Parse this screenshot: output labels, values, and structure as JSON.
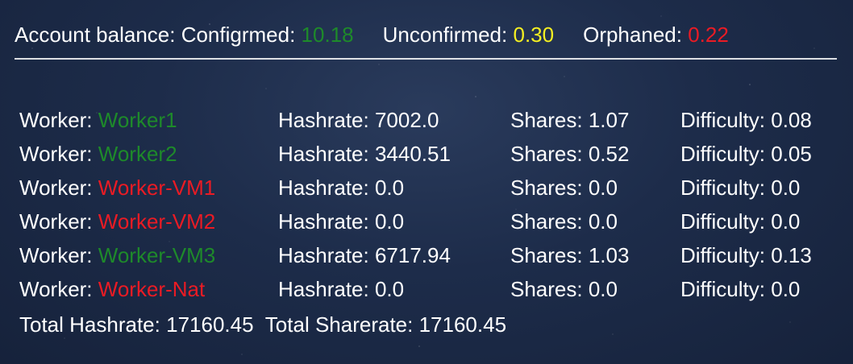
{
  "colors": {
    "confirmed": "#1e8a2a",
    "unconfirmed": "#f4ef22",
    "orphaned": "#ea1b24",
    "worker_active": "#1e8a2a",
    "worker_inactive": "#ea1b24"
  },
  "balance": {
    "confirmed_label": "Account balance: Configrmed:",
    "confirmed_value": "10.18",
    "unconfirmed_label": "Unconfirmed:",
    "unconfirmed_value": "0.30",
    "orphaned_label": "Orphaned:",
    "orphaned_value": "0.22"
  },
  "labels": {
    "worker": "Worker:",
    "hashrate": "Hashrate:",
    "shares": "Shares:",
    "difficulty": "Difficulty:"
  },
  "workers": [
    {
      "name": "Worker1",
      "status": "active",
      "hashrate": "7002.0",
      "shares": "1.07",
      "difficulty": "0.08"
    },
    {
      "name": "Worker2",
      "status": "active",
      "hashrate": "3440.51",
      "shares": "0.52",
      "difficulty": "0.05"
    },
    {
      "name": "Worker-VM1",
      "status": "inactive",
      "hashrate": "0.0",
      "shares": "0.0",
      "difficulty": "0.0"
    },
    {
      "name": "Worker-VM2",
      "status": "inactive",
      "hashrate": "0.0",
      "shares": "0.0",
      "difficulty": "0.0"
    },
    {
      "name": "Worker-VM3",
      "status": "active",
      "hashrate": "6717.94",
      "shares": "1.03",
      "difficulty": "0.13"
    },
    {
      "name": "Worker-Nat",
      "status": "inactive",
      "hashrate": "0.0",
      "shares": "0.0",
      "difficulty": "0.0"
    }
  ],
  "totals": {
    "hashrate_label": "Total Hashrate:",
    "hashrate_value": "17160.45",
    "sharerate_label": "Total Sharerate:",
    "sharerate_value": "17160.45"
  }
}
